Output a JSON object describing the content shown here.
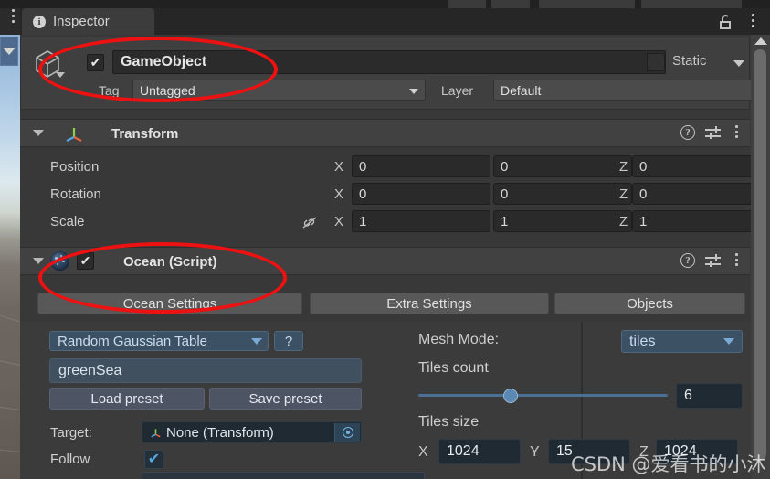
{
  "window": {
    "tab_label": "Inspector",
    "tab_icon": "info-icon",
    "lock_icon": "lock-open-icon",
    "menu_icon": "kebab-menu-icon"
  },
  "scene_panel": {
    "dropdown_icon": "chevron-down-icon",
    "menu_icon": "kebab-menu-icon"
  },
  "game_object": {
    "icon": "prefab-cube-icon",
    "enabled": true,
    "checkmark": "✔",
    "name": "GameObject",
    "static_label": "Static",
    "static_checked": false,
    "tag_label": "Tag",
    "tag_value": "Untagged",
    "layer_label": "Layer",
    "layer_value": "Default"
  },
  "transform": {
    "title": "Transform",
    "icon": "transform-axis-icon",
    "help_icon": "help-icon",
    "preset_icon": "preset-sliders-icon",
    "menu_icon": "kebab-menu-icon",
    "rows": [
      {
        "label": "Position",
        "x": "0",
        "y": "0",
        "z": "0"
      },
      {
        "label": "Rotation",
        "x": "0",
        "y": "0",
        "z": "0"
      },
      {
        "label": "Scale",
        "x": "1",
        "y": "1",
        "z": "1"
      }
    ],
    "axis_labels": {
      "x": "X",
      "y": "Y",
      "z": "Z"
    },
    "scale_link_icon": "constrain-proportions-off-icon"
  },
  "ocean_component": {
    "title": "Ocean (Script)",
    "icon": "ocean-script-icon",
    "enabled": true,
    "checkmark": "✔",
    "help_icon": "help-icon",
    "preset_icon": "preset-sliders-icon",
    "menu_icon": "kebab-menu-icon",
    "tabs": [
      {
        "label": "Ocean Settings",
        "selected": true
      },
      {
        "label": "Extra Settings",
        "selected": false
      },
      {
        "label": "Objects",
        "selected": false
      }
    ]
  },
  "ocean_settings": {
    "spectrum_dropdown": "Random Gaussian Table",
    "help_button": "?",
    "preset_dropdown": "greenSea",
    "load_preset_button": "Load preset",
    "save_preset_button": "Save preset",
    "target_label": "Target:",
    "target_value": "None (Transform)",
    "target_icon": "transform-axis-icon",
    "target_picker_icon": "object-picker-icon",
    "follow_label": "Follow",
    "follow_checked": true,
    "follow_checkmark": "✔"
  },
  "mesh_settings": {
    "mesh_mode_label": "Mesh Mode:",
    "mesh_mode_value": "tiles",
    "tiles_count_label": "Tiles count",
    "tiles_count_value": "6",
    "tiles_count_slider_percent": 34,
    "tiles_size_label": "Tiles size",
    "tiles_size": {
      "x_label": "X",
      "x": "1024",
      "y_label": "Y",
      "y": "15",
      "z_label": "Z",
      "z": "1024"
    }
  },
  "scrollbar": {
    "up_arrow_icon": "triangle-up-icon"
  },
  "annotations": {
    "ellipse_1": "highlight-gameobject-header",
    "ellipse_2": "highlight-ocean-settings-tab",
    "color": "#ee1111"
  },
  "watermark": {
    "text": "CSDN @爱看书的小沐"
  }
}
